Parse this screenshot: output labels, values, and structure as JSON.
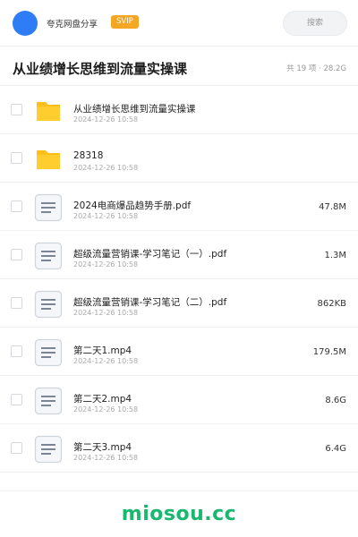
{
  "header": {
    "share_title": "夸克网盘分享",
    "badge": "SVIP",
    "search_placeholder": "搜索",
    "colors": {
      "avatar": "#2f7df6",
      "badge": "#f5a623",
      "watermark": "#19b86f"
    }
  },
  "folder": {
    "title": "从业绩增长思维到流量实操课",
    "meta": "共 19 项 · 28.2G"
  },
  "files": [
    {
      "type": "folder-icon",
      "name": "从业绩增长思维到流量实操课",
      "date": "2024-12-26 10:58",
      "size": ""
    },
    {
      "type": "folder-icon",
      "name": "28318",
      "date": "2024-12-26 10:58",
      "size": ""
    },
    {
      "type": "document-icon",
      "name": "2024电商爆品趋势手册.pdf",
      "date": "2024-12-26 10:58",
      "size": "47.8M"
    },
    {
      "type": "document-icon",
      "name": "超级流量营销课-学习笔记（一）.pdf",
      "date": "2024-12-26 10:58",
      "size": "1.3M"
    },
    {
      "type": "document-icon",
      "name": "超级流量营销课-学习笔记（二）.pdf",
      "date": "2024-12-26 10:58",
      "size": "862KB"
    },
    {
      "type": "document-icon",
      "name": "第二天1.mp4",
      "date": "2024-12-26 10:58",
      "size": "179.5M"
    },
    {
      "type": "document-icon",
      "name": "第二天2.mp4",
      "date": "2024-12-26 10:58",
      "size": "8.6G"
    },
    {
      "type": "document-icon",
      "name": "第二天3.mp4",
      "date": "2024-12-26 10:58",
      "size": "6.4G"
    }
  ],
  "watermark": "miosou.cc"
}
